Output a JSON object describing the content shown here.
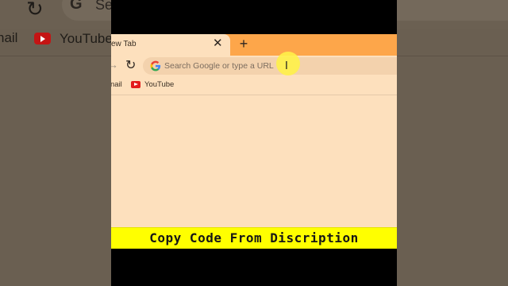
{
  "background": {
    "search_partial": "Se",
    "bookmark_partial": "nail",
    "bookmark_youtube": "YouTube"
  },
  "browser": {
    "tab_title": "ew Tab",
    "omnibox_placeholder": "Search Google or type a URL",
    "bookmarks": [
      {
        "label": "nail"
      },
      {
        "label": "YouTube"
      }
    ]
  },
  "caption": "Copy Code From Discription",
  "colors": {
    "tabstrip": "#fda64a",
    "page": "#fde0bd",
    "caption_bar": "#ffff00",
    "youtube_red": "#e31c1c"
  },
  "icons": [
    "close-icon",
    "plus-icon",
    "forward-icon",
    "reload-icon",
    "google-icon",
    "text-cursor-icon",
    "youtube-icon"
  ]
}
